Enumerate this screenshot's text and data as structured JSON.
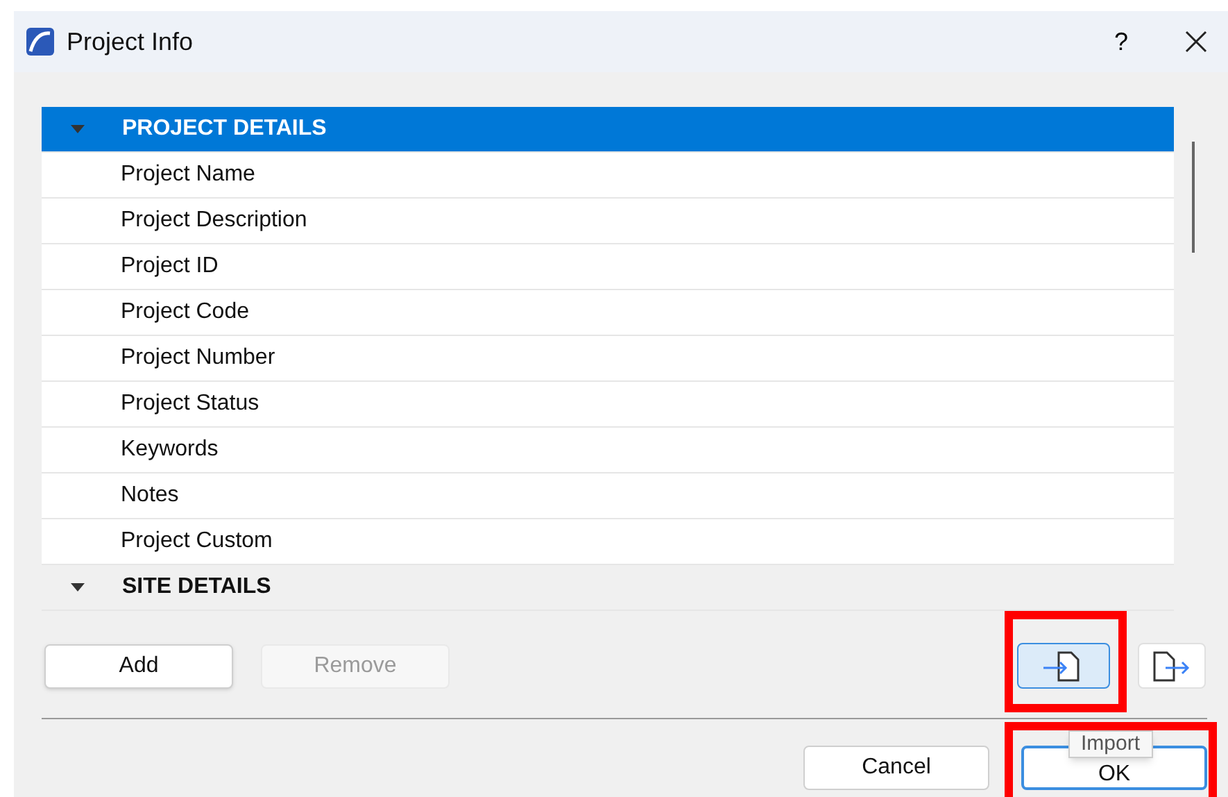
{
  "window": {
    "title": "Project Info",
    "help": "?"
  },
  "list": {
    "rows": [
      {
        "kind": "section",
        "label": "PROJECT DETAILS",
        "expanded": true,
        "selected": true
      },
      {
        "kind": "item",
        "label": "Project Name",
        "selected": false
      },
      {
        "kind": "item",
        "label": "Project Description",
        "selected": false
      },
      {
        "kind": "item",
        "label": "Project ID",
        "selected": false
      },
      {
        "kind": "item",
        "label": "Project Code",
        "selected": false
      },
      {
        "kind": "item",
        "label": "Project Number",
        "selected": false
      },
      {
        "kind": "item",
        "label": "Project Status",
        "selected": false
      },
      {
        "kind": "item",
        "label": "Keywords",
        "selected": false
      },
      {
        "kind": "item",
        "label": "Notes",
        "selected": false
      },
      {
        "kind": "item",
        "label": "Project Custom",
        "selected": false
      },
      {
        "kind": "section",
        "label": "SITE DETAILS",
        "expanded": true,
        "selected": false
      }
    ]
  },
  "edit_buttons": [
    {
      "label": "Add",
      "disabled": false
    },
    {
      "label": "Remove",
      "disabled": true
    }
  ],
  "file_buttons": [
    {
      "kind": "import",
      "selected": true
    },
    {
      "kind": "export",
      "selected": false
    }
  ],
  "tooltip": "Import",
  "dialog_buttons": [
    {
      "label": "Cancel",
      "default": false
    },
    {
      "label": "OK",
      "default": true
    }
  ]
}
